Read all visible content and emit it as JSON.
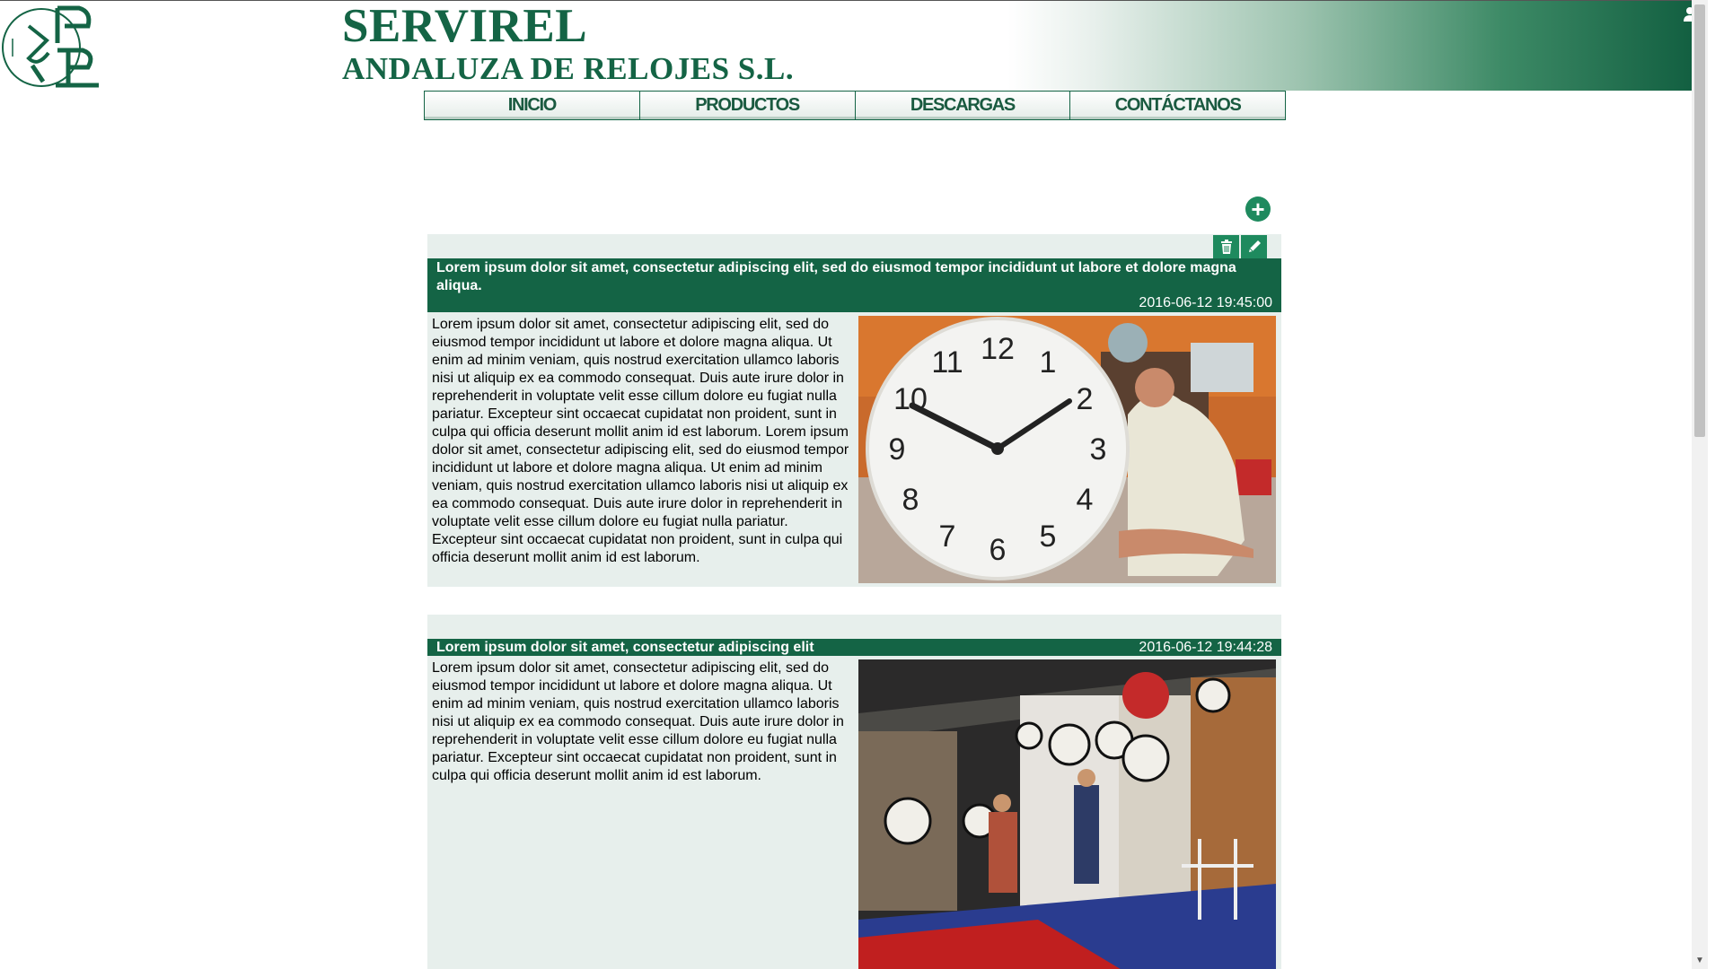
{
  "brand": {
    "title": "SERVIREL",
    "subtitle": "ANDALUZA DE RELOJES S.L.",
    "accent_color": "#146445",
    "button_color": "#1e8a5e"
  },
  "icons": {
    "logo": "clock-logo-icon",
    "user": "user-times-icon",
    "add": "plus-circle-icon",
    "delete": "trash-icon",
    "edit": "pencil-icon"
  },
  "nav": {
    "items": [
      {
        "label": "INICIO"
      },
      {
        "label": "PRODUCTOS"
      },
      {
        "label": "DESCARGAS"
      },
      {
        "label": "CONTÁCTANOS"
      }
    ]
  },
  "add_button": {
    "symbol": "+"
  },
  "posts": [
    {
      "title": "Lorem ipsum dolor sit amet, consectetur adipiscing elit, sed do eiusmod tempor incididunt ut labore et dolore magna aliqua.",
      "date": "2016-06-12 19:45:00",
      "body": "Lorem ipsum dolor sit amet, consectetur adipiscing elit, sed do eiusmod tempor incididunt ut labore et dolore magna aliqua. Ut enim ad minim veniam, quis nostrud exercitation ullamco laboris nisi ut aliquip ex ea commodo consequat. Duis aute irure dolor in reprehenderit in voluptate velit esse cillum dolore eu fugiat nulla pariatur. Excepteur sint occaecat cupidatat non proident, sunt in culpa qui officia deserunt mollit anim id est laborum. Lorem ipsum dolor sit amet, consectetur adipiscing elit, sed do eiusmod tempor incididunt ut labore et dolore magna aliqua. Ut enim ad minim veniam, quis nostrud exercitation ullamco laboris nisi ut aliquip ex ea commodo consequat. Duis aute irure dolor in reprehenderit in voluptate velit esse cillum dolore eu fugiat nulla pariatur. Excepteur sint occaecat cupidatat non proident, sunt in culpa qui officia deserunt mollit anim id est laborum."
    },
    {
      "title": "Lorem ipsum dolor sit amet, consectetur adipiscing elit",
      "date": "2016-06-12 19:44:28",
      "body": "Lorem ipsum dolor sit amet, consectetur adipiscing elit, sed do eiusmod tempor incididunt ut labore et dolore magna aliqua. Ut enim ad minim veniam, quis nostrud exercitation ullamco laboris nisi ut aliquip ex ea commodo consequat. Duis aute irure dolor in reprehenderit in voluptate velit esse cillum dolore eu fugiat nulla pariatur. Excepteur sint occaecat cupidatat non proident, sunt in culpa qui officia deserunt mollit anim id est laborum."
    }
  ],
  "clock_numerals": [
    "12",
    "1",
    "2",
    "3",
    "4",
    "5",
    "6",
    "7",
    "8",
    "9",
    "10",
    "11"
  ]
}
